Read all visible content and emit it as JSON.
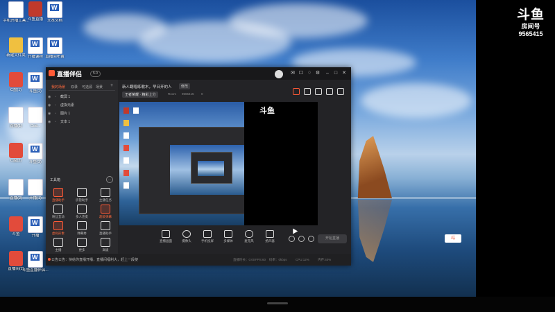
{
  "desktop_icons": [
    {
      "label": "手机开播工具...",
      "kind": "doc"
    },
    {
      "label": "斗鱼直播",
      "kind": "app"
    },
    {
      "label": "文本文档",
      "kind": "word"
    },
    {
      "label": "新建文件夹",
      "kind": "folder"
    },
    {
      "label": "开播课程",
      "kind": "word"
    },
    {
      "label": "直播间布置",
      "kind": "word"
    },
    {
      "label": "C盘(1)",
      "kind": "pdf"
    },
    {
      "label": "斗鱼(2)",
      "kind": "word"
    },
    {
      "label": "直播(1)",
      "kind": "doc"
    },
    {
      "label": "Cod...",
      "kind": "doc"
    },
    {
      "label": "C盘(2)",
      "kind": "pdf"
    },
    {
      "label": "斗鱼(3)",
      "kind": "word"
    },
    {
      "label": "直播(2)",
      "kind": "doc"
    },
    {
      "label": "开播(1)",
      "kind": "doc"
    },
    {
      "label": "斗鱼",
      "kind": "pdf"
    },
    {
      "label": "开播",
      "kind": "word"
    },
    {
      "label": "直播间(2)",
      "kind": "pdf"
    },
    {
      "label": "斗鱼直播伴侣...",
      "kind": "word"
    }
  ],
  "logo": {
    "mark": "斗鱼",
    "sub": "房间号",
    "room": "9565415"
  },
  "badge": "斗",
  "app": {
    "title": "直播伴侣",
    "version": "5.0",
    "sidebar_tabs": [
      "我的场景",
      "双录",
      "可选源",
      "场景"
    ],
    "sources": [
      "截屏 1",
      "虚拟元素",
      "图片 1",
      "文本 1"
    ],
    "toolbox_label": "工具箱",
    "tools": [
      {
        "label": "直播助手",
        "red": true
      },
      {
        "label": "房管助手",
        "red": false
      },
      {
        "label": "主播任务",
        "red": false
      },
      {
        "label": "粉丝互动",
        "red": false
      },
      {
        "label": "多人连麦",
        "red": false
      },
      {
        "label": "超级弹幕",
        "red": true
      },
      {
        "label": "虚拟形象",
        "red": true
      },
      {
        "label": "弹幕秀",
        "red": false
      },
      {
        "label": "直播助手",
        "red": false
      },
      {
        "label": "主播",
        "red": false
      },
      {
        "label": "更多",
        "red": false
      },
      {
        "label": "高级",
        "red": false
      }
    ],
    "room_title": "新人翻唱练歌木，早日开的人",
    "edit_label": "修改",
    "category_label": "王者荣耀 · 精彩上分",
    "meta": [
      "Room",
      "9565415",
      "0"
    ],
    "controls": [
      "直播画面",
      "摄像头",
      "手机投屏",
      "多媒体",
      "麦克风",
      "扬声器"
    ],
    "start_label": "开始直播",
    "tip": "公告公告：快给你直播开播，直播间福利大，赶上一段使",
    "stats": [
      "直播时长：0:00",
      "FPS:60",
      "码率：0kbps",
      "CPU:12%",
      "内存:40%"
    ]
  }
}
